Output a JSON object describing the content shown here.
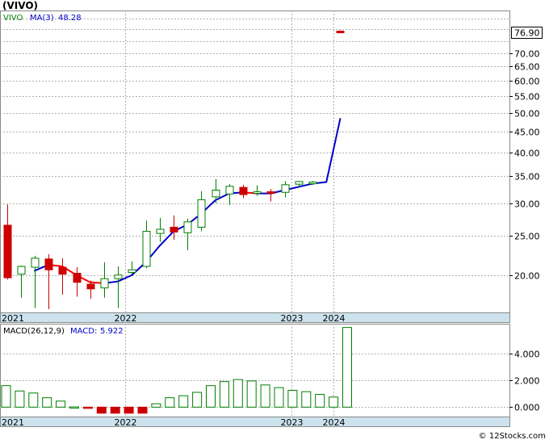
{
  "chart_data": [
    {
      "type": "candlestick",
      "title": "(VIVO)",
      "legend": [
        {
          "name": "VIVO",
          "color": "#008000"
        },
        {
          "name": "MA(3)",
          "value": "48.28",
          "color": "#0000cc"
        }
      ],
      "scale": "log",
      "ylim": [
        16.2,
        89
      ],
      "y_ticks": [
        20,
        25,
        30,
        35,
        40,
        45,
        50,
        55,
        60,
        65,
        70
      ],
      "y_tick_labels": [
        "20.00",
        "25.00",
        "30.00",
        "35.00",
        "40.00",
        "45.00",
        "50.00",
        "55.00",
        "60.00",
        "65.00",
        "70.00"
      ],
      "last_price": "76.90",
      "x_labels": [
        "2021",
        "2022",
        "2023",
        "2024"
      ],
      "colors": {
        "up": "#008000",
        "down": "#cc0000",
        "ma": "#0000cc",
        "ma_down": "#ff0000"
      },
      "candles": [
        {
          "o": 26.5,
          "h": 29.8,
          "l": 19.5,
          "c": 19.7
        },
        {
          "o": 20.1,
          "h": 21.1,
          "l": 17.6,
          "c": 21.0
        },
        {
          "o": 20.9,
          "h": 22.3,
          "l": 16.6,
          "c": 22.0
        },
        {
          "o": 21.9,
          "h": 22.5,
          "l": 16.5,
          "c": 20.6
        },
        {
          "o": 20.9,
          "h": 22.0,
          "l": 17.9,
          "c": 20.1
        },
        {
          "o": 20.2,
          "h": 20.9,
          "l": 17.7,
          "c": 19.2
        },
        {
          "o": 19.0,
          "h": 19.4,
          "l": 17.5,
          "c": 18.5
        },
        {
          "o": 18.6,
          "h": 21.5,
          "l": 17.6,
          "c": 19.6
        },
        {
          "o": 19.6,
          "h": 21.0,
          "l": 16.6,
          "c": 20.0
        },
        {
          "o": 20.3,
          "h": 21.6,
          "l": 20.1,
          "c": 20.6
        },
        {
          "o": 21.0,
          "h": 27.2,
          "l": 20.8,
          "c": 25.6
        },
        {
          "o": 25.3,
          "h": 27.6,
          "l": 24.1,
          "c": 25.9
        },
        {
          "o": 26.2,
          "h": 28.0,
          "l": 24.4,
          "c": 25.5
        },
        {
          "o": 25.4,
          "h": 27.5,
          "l": 23.0,
          "c": 27.0
        },
        {
          "o": 26.2,
          "h": 32.1,
          "l": 25.6,
          "c": 30.6
        },
        {
          "o": 31.1,
          "h": 34.4,
          "l": 30.0,
          "c": 32.3
        },
        {
          "o": 31.6,
          "h": 33.4,
          "l": 29.7,
          "c": 33.0
        },
        {
          "o": 32.8,
          "h": 33.3,
          "l": 30.9,
          "c": 31.5
        },
        {
          "o": 31.9,
          "h": 33.2,
          "l": 31.3,
          "c": 32.0
        },
        {
          "o": 32.0,
          "h": 32.5,
          "l": 30.3,
          "c": 31.7
        },
        {
          "o": 31.9,
          "h": 34.0,
          "l": 31.0,
          "c": 33.3
        },
        {
          "o": 33.4,
          "h": 34.0,
          "l": 32.8,
          "c": 33.9
        },
        {
          "o": 33.7,
          "h": 34.0,
          "l": 33.3,
          "c": 33.8
        },
        null,
        {
          "o": 79.2,
          "h": 79.5,
          "l": 78.5,
          "c": 78.8
        }
      ],
      "ma3": [
        null,
        null,
        20.5,
        21.2,
        21.0,
        20.0,
        19.2,
        19.1,
        19.3,
        20.0,
        21.5,
        23.6,
        25.6,
        26.6,
        28.3,
        30.5,
        31.7,
        31.9,
        31.7,
        31.7,
        32.3,
        32.9,
        33.5,
        33.8,
        48.3
      ]
    },
    {
      "type": "bar",
      "title": "MACD(26,12,9)",
      "legend": [
        {
          "name": "MACD(26,12,9)",
          "color": "#000000"
        },
        {
          "name": "MACD:",
          "value": "5.922",
          "color": "#0000cc"
        }
      ],
      "ylim": [
        -0.7,
        6.2
      ],
      "y_ticks": [
        0,
        2,
        4
      ],
      "y_tick_labels": [
        "0.000",
        "2.000",
        "4.000"
      ],
      "x_labels": [
        "2021",
        "2022",
        "2023",
        "2024"
      ],
      "values": [
        1.6,
        1.2,
        1.05,
        0.7,
        0.45,
        0.02,
        -0.08,
        -0.45,
        -0.45,
        -0.45,
        -0.45,
        0.25,
        0.7,
        0.85,
        1.1,
        1.6,
        1.9,
        2.05,
        1.95,
        1.65,
        1.45,
        1.25,
        1.15,
        0.95,
        0.75,
        5.922
      ]
    }
  ],
  "footer": {
    "copyright": "© 12Stocks.com"
  }
}
